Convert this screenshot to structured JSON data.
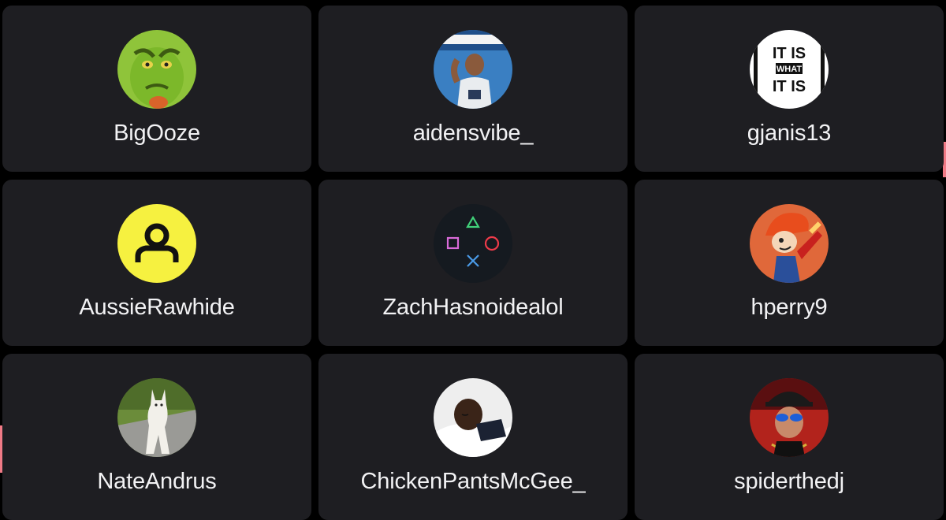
{
  "accent_colors": {
    "card_bg": "#1e1e22",
    "page_bg": "#000000",
    "text": "#f2f2f4",
    "edge_pink": "#f07a86"
  },
  "users": [
    {
      "username": "BigOoze",
      "avatar": "grinch-avatar"
    },
    {
      "username": "aidensvibe_",
      "avatar": "basketball-player-avatar"
    },
    {
      "username": "gjanis13",
      "avatar": "it-is-what-it-is-avatar",
      "avatar_text": [
        "IT IS",
        "WHAT",
        "IT IS"
      ]
    },
    {
      "username": "AussieRawhide",
      "avatar": "default-user-icon"
    },
    {
      "username": "ZachHasnoidealol",
      "avatar": "playstation-buttons-avatar"
    },
    {
      "username": "hperry9",
      "avatar": "cartoon-guitarist-avatar"
    },
    {
      "username": "NateAndrus",
      "avatar": "white-dog-avatar"
    },
    {
      "username": "ChickenPantsMcGee_",
      "avatar": "sleeping-kid-avatar"
    },
    {
      "username": "spiderthedj",
      "avatar": "dj-sunglasses-avatar"
    }
  ]
}
